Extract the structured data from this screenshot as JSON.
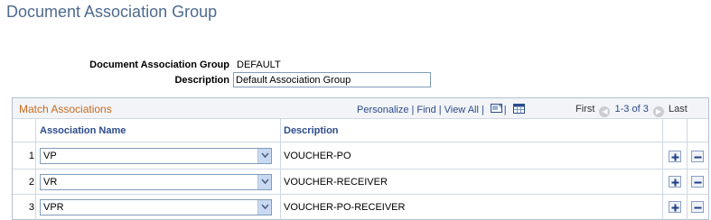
{
  "page": {
    "title": "Document Association Group"
  },
  "form": {
    "group_label": "Document Association Group",
    "group_value": "DEFAULT",
    "description_label": "Description",
    "description_value": "Default Association Group"
  },
  "grid": {
    "title": "Match Associations",
    "nav": {
      "personalize": "Personalize",
      "find": "Find",
      "view_all": "View All"
    },
    "pager": {
      "first": "First",
      "count": "1-3 of 3",
      "last": "Last"
    },
    "columns": {
      "name": "Association Name",
      "description": "Description"
    },
    "rows": [
      {
        "num": "1",
        "name": "VP",
        "description": "VOUCHER-PO"
      },
      {
        "num": "2",
        "name": "VR",
        "description": "VOUCHER-RECEIVER"
      },
      {
        "num": "3",
        "name": "VPR",
        "description": "VOUCHER-PO-RECEIVER"
      }
    ]
  },
  "icons": {
    "zoom": "zoom-icon",
    "download": "download-grid-icon",
    "add": "plus-icon",
    "delete": "minus-icon"
  },
  "colors": {
    "title": "#4e6a8f",
    "grid_title": "#c76c1e",
    "link": "#2c4b8a"
  }
}
